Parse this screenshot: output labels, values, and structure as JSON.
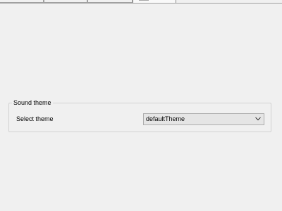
{
  "tabs": [
    {
      "icon": "gear-icon"
    },
    {
      "icon": "pin-icon"
    },
    {
      "icon": "display-icon"
    },
    {
      "icon": "speaker-icon",
      "selected": true
    }
  ],
  "sound_theme": {
    "group_title": "Sound theme",
    "select_label": "Select theme",
    "selected_value": "defaultTheme"
  }
}
